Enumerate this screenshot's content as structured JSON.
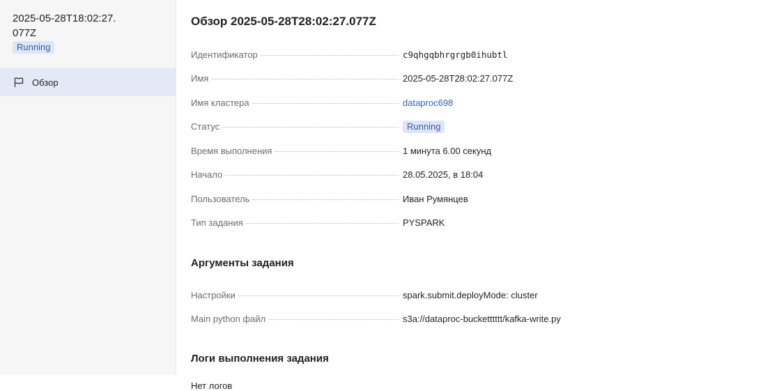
{
  "sidebar": {
    "title": "2025-05-28T18:02:27.077Z",
    "status": "Running",
    "nav": [
      {
        "label": "Обзор",
        "icon": "flag-icon"
      }
    ]
  },
  "main": {
    "title": "Обзор 2025-05-28T28:02:27.077Z",
    "fields": {
      "id": {
        "label": "Идентификатор",
        "value": "c9qhgqbhrgrgb0ihubtl"
      },
      "name": {
        "label": "Имя",
        "value": "2025-05-28T28:02:27.077Z"
      },
      "cluster": {
        "label": "Имя кластера",
        "value": "dataproc698"
      },
      "status": {
        "label": "Статус",
        "value": "Running"
      },
      "duration": {
        "label": "Время выполнения",
        "value": "1 минута 6.00 секунд"
      },
      "start": {
        "label": "Начало",
        "value": "28.05.2025, в 18:04"
      },
      "user": {
        "label": "Пользователь",
        "value": "Иван Румянцев"
      },
      "type": {
        "label": "Тип задания",
        "value": "PYSPARK"
      }
    },
    "args_section": {
      "title": "Аргументы задания",
      "settings": {
        "label": "Настройки",
        "value": "spark.submit.deployMode: cluster"
      },
      "main_file": {
        "label": "Main python файл",
        "value": "s3a://dataproc-bucketttttt/kafka-write.py"
      }
    },
    "logs_section": {
      "title": "Логи выполнения задания",
      "empty": "Нет логов"
    }
  },
  "colors": {
    "accent_link": "#3561b3",
    "badge_bg": "#dde6f8",
    "nav_active_bg": "#e3e9f6"
  }
}
